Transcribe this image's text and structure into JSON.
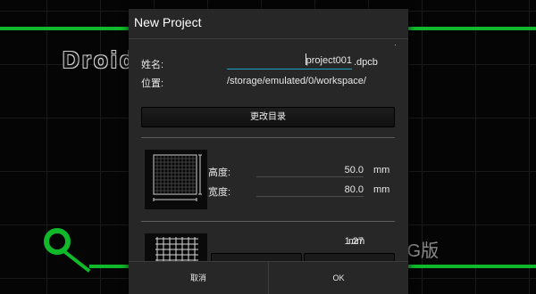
{
  "background": {
    "logo_text": "Droid",
    "version_text": ".G版"
  },
  "dialog": {
    "title": "New Project",
    "name_label": "姓名:",
    "name_value": "project001",
    "extension": ".dpcb",
    "location_label": "位置:",
    "location_value": "/storage/emulated/0/workspace/",
    "change_dir_label": "更改目录",
    "height_label": "高度:",
    "height_value": "50.0",
    "height_unit": "mm",
    "width_label": "宽度:",
    "width_value": "80.0",
    "width_unit": "mm",
    "grid_value": "1.27",
    "grid_unit": "mm",
    "cancel_label": "取消",
    "ok_label": "OK"
  },
  "colors": {
    "trace": "#0fb92a",
    "accent": "#16a3c7",
    "dialog_bg": "#272727"
  }
}
